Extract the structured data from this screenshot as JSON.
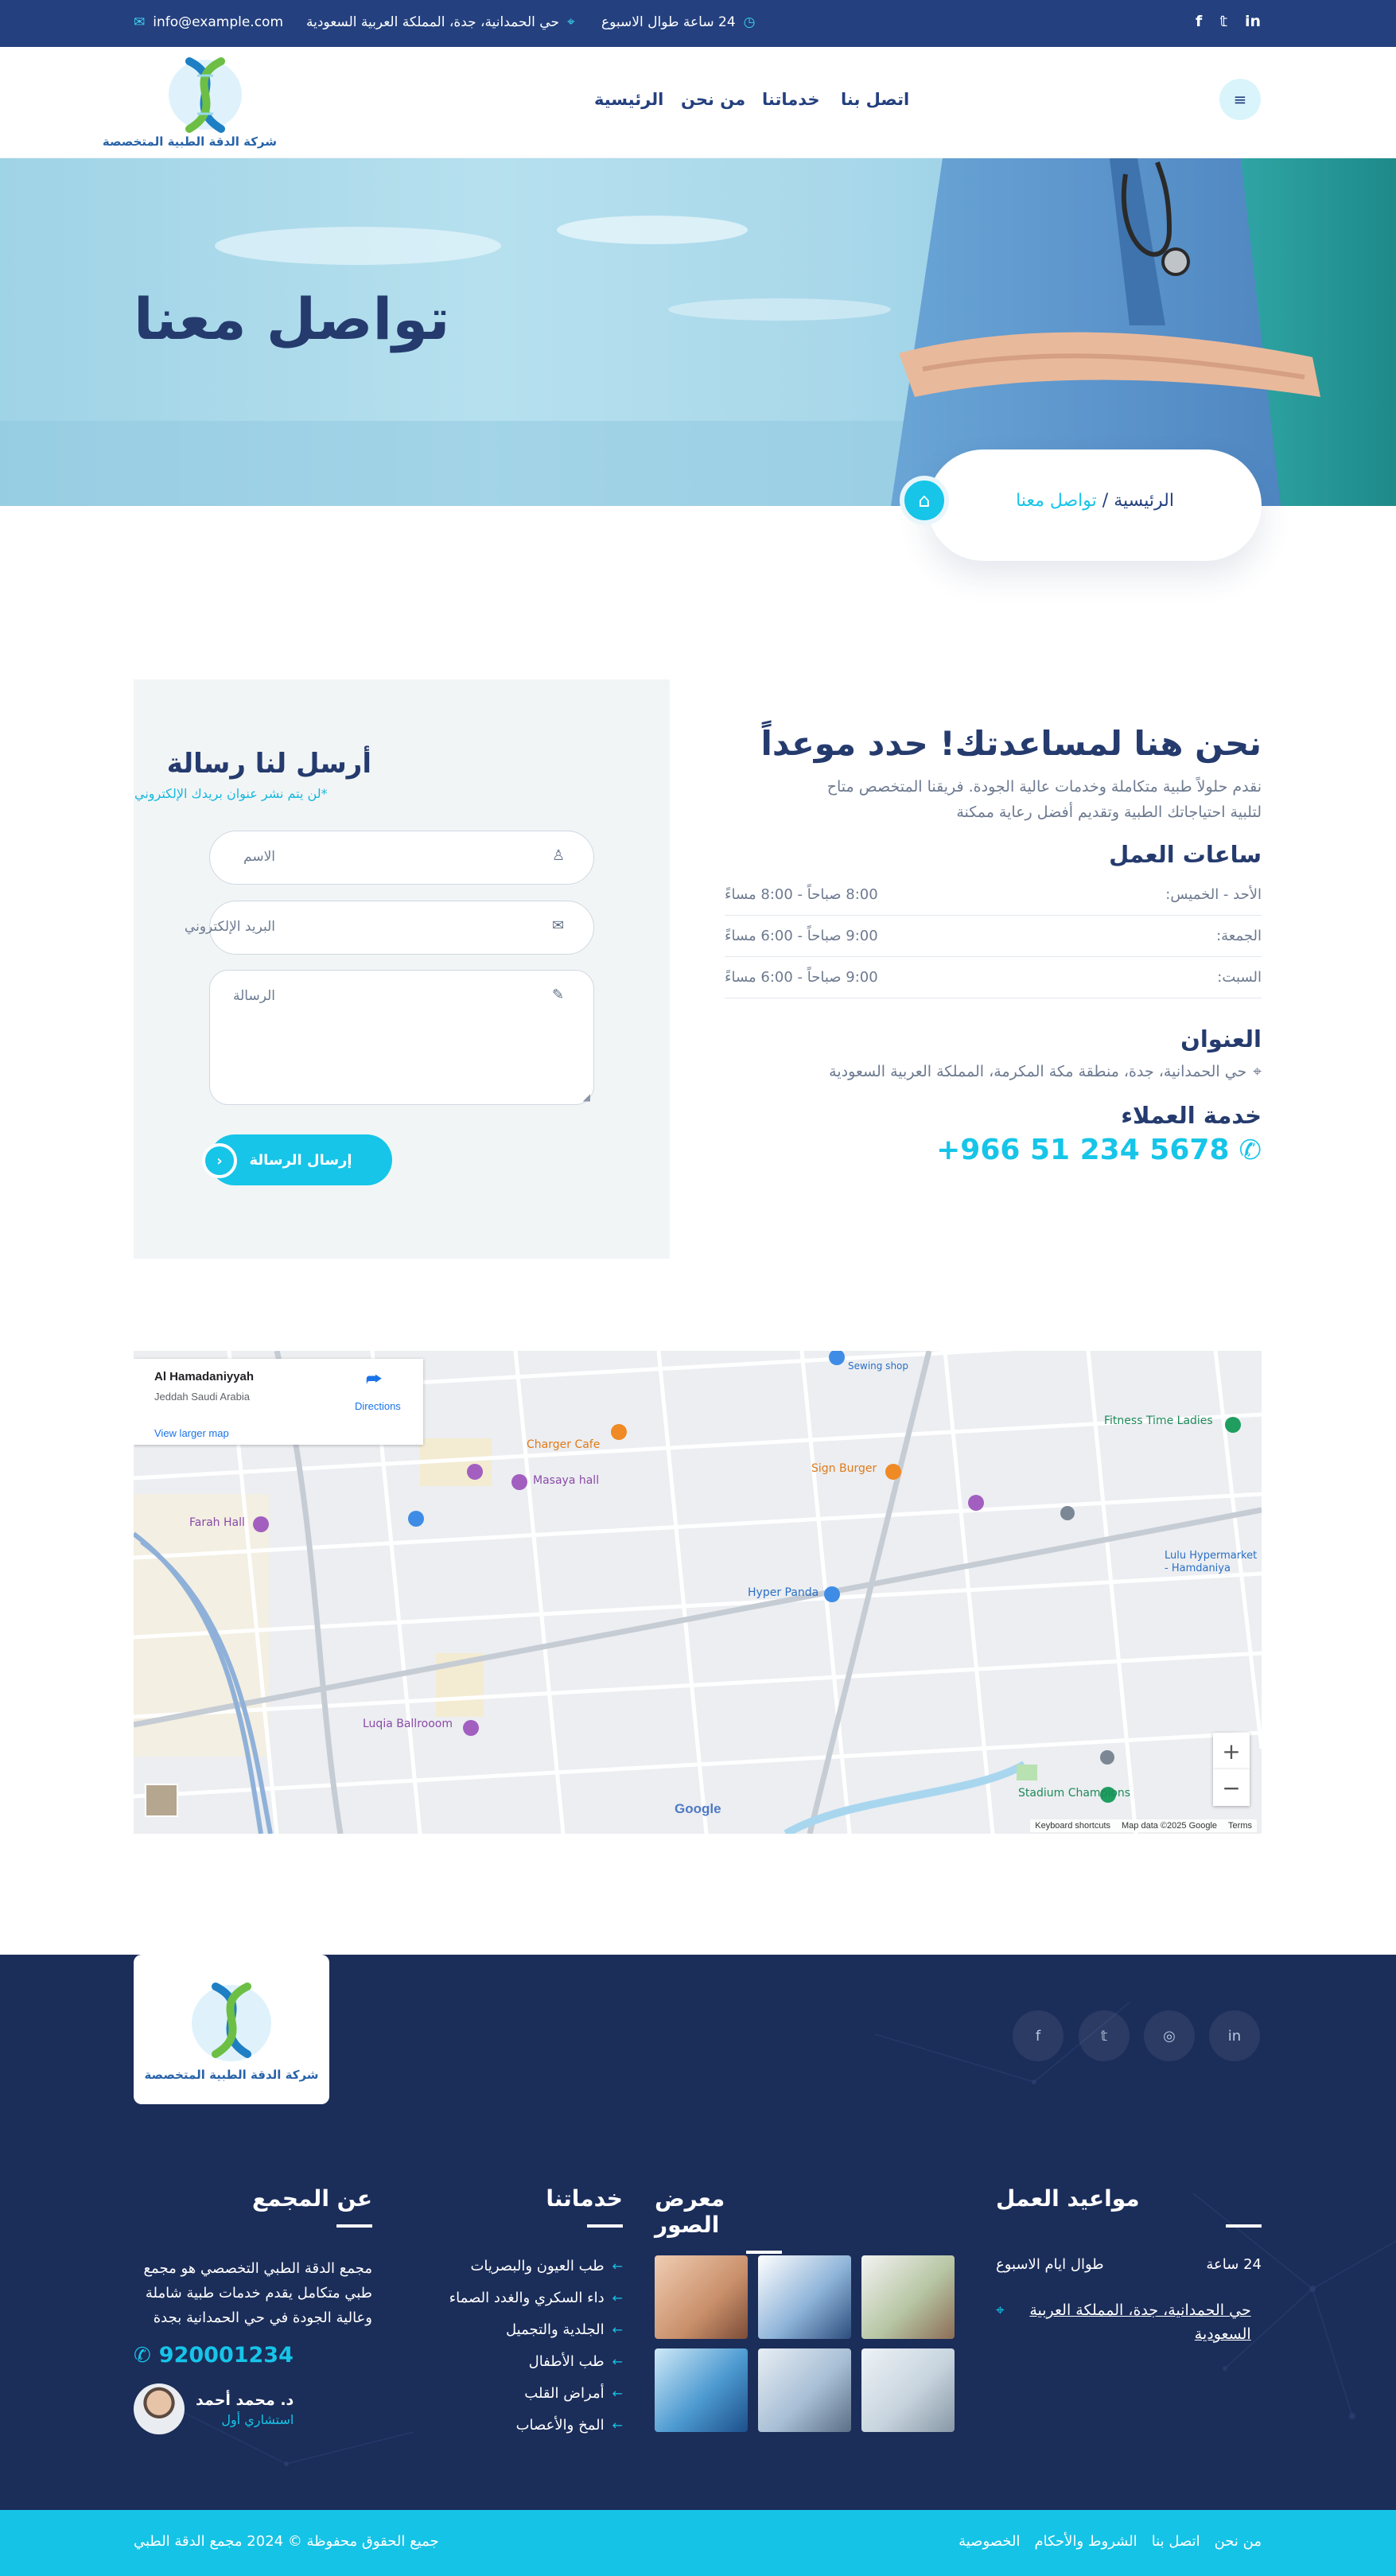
{
  "topbar": {
    "email": "info@example.com",
    "address": "حي الحمدانية، جدة، المملكة العربية السعودية",
    "hours": "24 ساعة طوال الاسبوع",
    "social": [
      "in",
      "t",
      "f"
    ]
  },
  "header": {
    "logo_text": "شركة الدقة الطبية المتخصصة",
    "nav": [
      "الرئيسية",
      "من نحن",
      "خدماتنا",
      "اتصل بنا"
    ]
  },
  "hero": {
    "title": "تواصل معنا",
    "breadcrumb_home": "الرئيسية",
    "breadcrumb_sep": "/",
    "breadcrumb_current": "تواصل معنا"
  },
  "form": {
    "title": "أرسل لنا رسالة",
    "subtitle": "*لن يتم نشر عنوان بريدك الإلكتروني",
    "name_placeholder": "الاسم",
    "email_placeholder": "البريد الإلكتروني",
    "message_placeholder": "الرسالة",
    "send_label": "إرسال الرسالة"
  },
  "info": {
    "title": "نحن هنا لمساعدتك! حدد موعداً",
    "desc_line1": "نقدم حلولاً طبية متكاملة وخدمات عالية الجودة. فريقنا المتخصص متاح",
    "desc_line2": "لتلبية احتياجاتك الطبية وتقديم أفضل رعاية ممكنة",
    "hours_title": "ساعات العمل",
    "hours": [
      {
        "day": "الأحد - الخميس:",
        "time": "8:00 صباحاً - 8:00 مساءً"
      },
      {
        "day": "الجمعة:",
        "time": "9:00 صباحاً - 6:00 مساءً"
      },
      {
        "day": "السبت:",
        "time": "9:00 صباحاً - 6:00 مساءً"
      }
    ],
    "address_title": "العنوان",
    "address": "حي الحمدانية، جدة، منطقة مكة المكرمة، المملكة العربية السعودية",
    "service_title": "خدمة العملاء",
    "phone": "+966 51 234 5678"
  },
  "map": {
    "place": "Al Hamadaniyyah",
    "region": "Jeddah Saudi Arabia",
    "directions": "Directions",
    "larger": "View larger map",
    "labels": [
      "Fitness Time Ladies",
      "Sign Burger",
      "Masaya hall",
      "Hyper Panda",
      "Lulu Hypermarket - Hamdaniya",
      "Luqia Ballrooom",
      "Farah Hall",
      "Stadium Champions",
      "Charger Cafe",
      "Sewing shop"
    ],
    "google": "Google",
    "keyboard": "Keyboard shortcuts",
    "mapdata": "Map data ©2025 Google",
    "terms": "Terms"
  },
  "footer": {
    "logo_text": "شركة الدقة الطبية المتخصصة",
    "social": [
      "in",
      "ig",
      "t",
      "f"
    ],
    "about_title": "عن المجمع",
    "about_text": [
      "مجمع الدقة الطبي التخصصي هو مجمع",
      "طبي متكامل يقدم خدمات طبية شاملة",
      "وعالية الجودة في حي الحمدانية بجدة"
    ],
    "about_phone": "920001234",
    "doctor_name": "د. محمد أحمد",
    "doctor_title": "استشاري أول",
    "services_title": "خدماتنا",
    "services": [
      "طب العيون والبصريات",
      "داء السكري والغدد الصماء",
      "الجلدية والتجميل",
      "طب الأطفال",
      "أمراض القلب",
      "المخ والأعصاب"
    ],
    "gallery_title": "معرض الصور",
    "hours_title": "مواعيد العمل",
    "hours_label": "طوال ايام الاسبوع",
    "hours_value": "24 ساعة",
    "address": "حي الحمدانية، جدة، المملكة العربية السعودية"
  },
  "bottombar": {
    "copyright": "جميع الحقوق محفوظة © 2024 مجمع الدقة الطبي",
    "links": [
      "من نحن",
      "اتصل بنا",
      "الشروط والأحكام",
      "الخصوصية"
    ]
  },
  "colors": {
    "primary": "#24407e",
    "accent": "#16c5e8",
    "footer": "#1b2d59"
  }
}
